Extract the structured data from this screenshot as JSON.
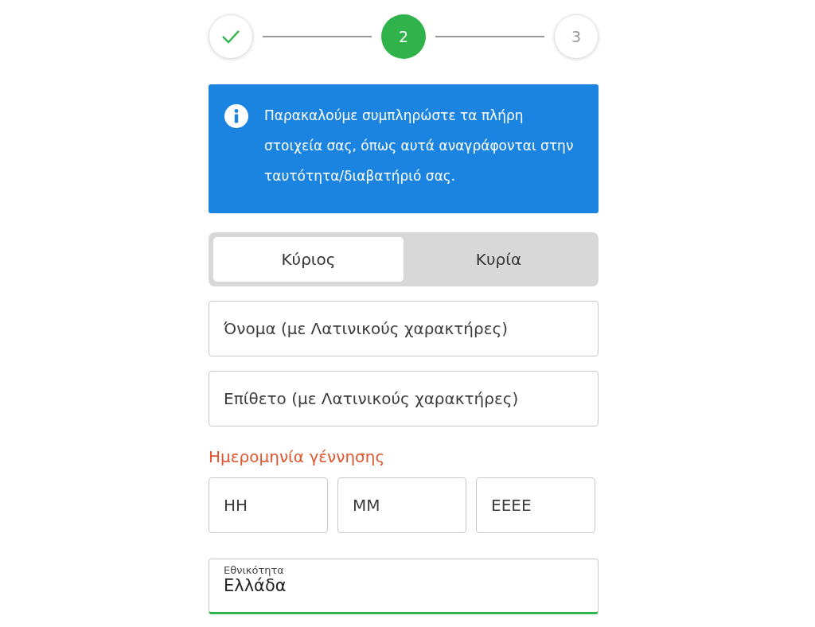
{
  "steps": [
    {
      "kind": "done"
    },
    {
      "label": "2",
      "kind": "current"
    },
    {
      "label": "3",
      "kind": "upcoming"
    }
  ],
  "info": {
    "text": "Παρακαλούμε συμπληρώστε τα πλήρη στοιχεία σας, όπως αυτά αναγράφονται στην ταυτότητα/διαβατήριό σας."
  },
  "title_tabs": [
    {
      "label": "Κύριος",
      "selected": true
    },
    {
      "label": "Κυρία",
      "selected": false
    }
  ],
  "name_fields": [
    {
      "placeholder": "Όνομα (με Λατινικούς χαρακτήρες)"
    },
    {
      "placeholder": "Επίθετο (με Λατινικούς χαρακτήρες)"
    }
  ],
  "birth_date": {
    "label": "Ημερομηνία γέννησης",
    "error": true,
    "fields": [
      {
        "placeholder": "ΗΗ"
      },
      {
        "placeholder": "ΜΜ"
      },
      {
        "placeholder": "ΕΕΕΕ"
      }
    ]
  },
  "nationality": {
    "label": "Εθνικότητα",
    "value": "Ελλάδα",
    "valid": true
  }
}
